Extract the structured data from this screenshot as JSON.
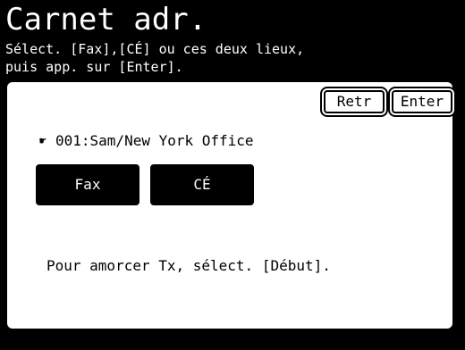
{
  "screen": {
    "title": "Carnet adr.",
    "instruction_line1": "Sélect. [Fax],[CÉ] ou ces deux lieux,",
    "instruction_line2": "puis app. sur [Enter]."
  },
  "toolbar": {
    "retr_label": "Retr",
    "enter_label": "Enter"
  },
  "entry": {
    "hand_icon": "hand-pointer-icon",
    "label": "001:Sam/New York Office"
  },
  "destinations": [
    {
      "label": "Fax",
      "selected": true
    },
    {
      "label": "CÉ",
      "selected": true
    }
  ],
  "info_text": "Pour amorcer Tx, sélect. [Début].",
  "colors": {
    "background": "#000000",
    "panel": "#ffffff",
    "text_on_dark": "#ffffff",
    "text_on_light": "#000000"
  }
}
